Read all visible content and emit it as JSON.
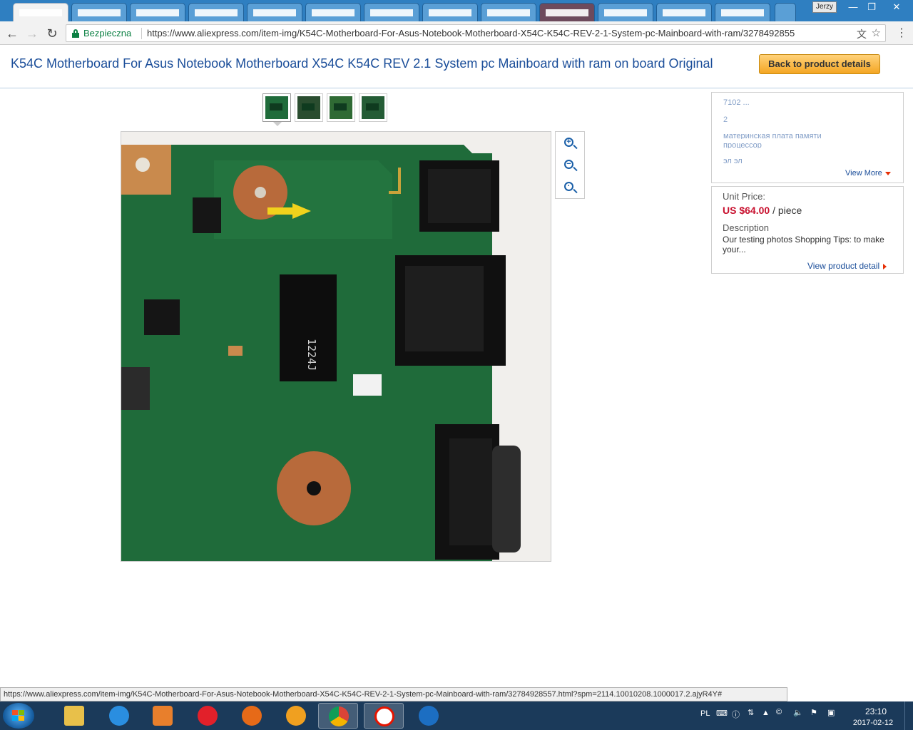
{
  "browser": {
    "profile_name": "Jerzy",
    "window_controls": {
      "minimize": "—",
      "maximize": "❐",
      "close": "✕"
    },
    "security_label": "Bezpieczna",
    "url": "https://www.aliexpress.com/item-img/K54C-Motherboard-For-Asus-Notebook-Motherboard-X54C-K54C-REV-2-1-System-pc-Mainboard-with-ram/3278492855",
    "status_url": "https://www.aliexpress.com/item-img/K54C-Motherboard-For-Asus-Notebook-Motherboard-X54C-K54C-REV-2-1-System-pc-Mainboard-with-ram/32784928557.html?spm=2114.10010208.1000017.2.ajyR4Y#"
  },
  "page": {
    "title": "K54C Motherboard For Asus Notebook Motherboard X54C K54C REV 2.1 System pc Mainboard with ram on board Original",
    "back_button": "Back to product details",
    "thumbnails": [
      "thumb-1",
      "thumb-2",
      "thumb-3",
      "thumb-4"
    ],
    "zoom_controls": [
      "zoom-in-icon",
      "zoom-out-icon",
      "zoom-reset-icon"
    ]
  },
  "side_box_specs": {
    "lines": [
      "7102 ...",
      "2",
      "материнская плата памяти",
      "процессор",
      "эл эл"
    ],
    "view_more": "View More"
  },
  "side_box_price": {
    "unit_price_label": "Unit Price:",
    "price": "US $64.00",
    "unit": "/ piece",
    "description_label": "Description",
    "description_text": "Our testing photos  Shopping Tips: to make your...",
    "view_detail": "View product detail"
  },
  "taskbar": {
    "apps": [
      "file-explorer-icon",
      "internet-explorer-icon",
      "media-player-icon",
      "opera-icon",
      "firefox-icon",
      "helm-app-icon",
      "chrome-icon",
      "yandex-icon",
      "ccleaner-icon"
    ],
    "language": "PL",
    "time": "23:10",
    "date": "2017-02-12"
  },
  "colors": {
    "title_blue": "#1a4d99",
    "price_red": "#c8102e",
    "button_orange": "#f4a623",
    "secure_green": "#0b8043"
  }
}
